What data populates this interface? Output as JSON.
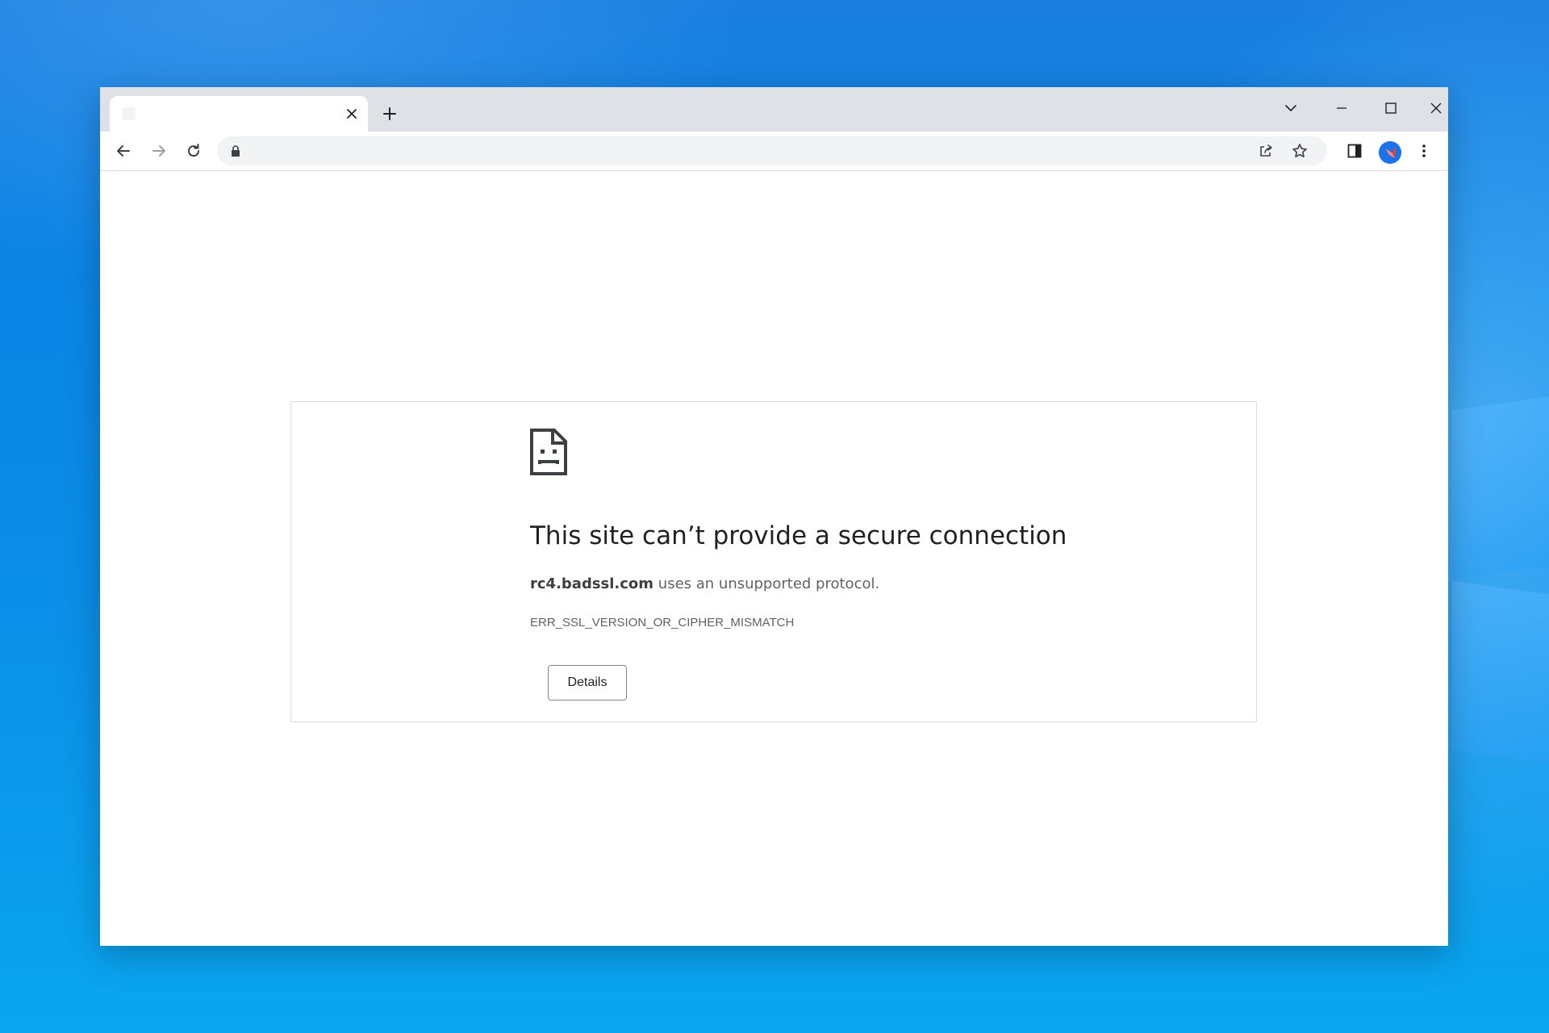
{
  "browser": {
    "tab": {
      "title": "",
      "close_icon": "close-icon",
      "favicon": "page-icon"
    },
    "new_tab_icon": "plus-icon",
    "window_controls": [
      "tab-search-icon",
      "minimize-icon",
      "maximize-icon",
      "close-icon"
    ],
    "toolbar": {
      "back_icon": "arrow-left-icon",
      "forward_icon": "arrow-right-icon",
      "reload_icon": "reload-icon",
      "address_value": "",
      "lock_icon": "lock-icon",
      "share_icon": "share-icon",
      "bookmark_icon": "star-icon",
      "side_panel_icon": "side-panel-icon",
      "menu_icon": "kebab-menu-icon"
    }
  },
  "error_page": {
    "icon": "sad-document-icon",
    "heading": "This site can’t provide a secure connection",
    "host": "rc4.badssl.com",
    "description_rest": " uses an unsupported protocol.",
    "error_code": "ERR_SSL_VERSION_OR_CIPHER_MISMATCH",
    "details_button": "Details"
  },
  "colors": {
    "desktop_background": "#0a86e6",
    "tabstrip": "#dee1e6",
    "omnibox": "#f1f3f4",
    "avatar_blue": "#1a73e8",
    "text_primary": "#202124",
    "text_secondary": "#5f6368"
  }
}
